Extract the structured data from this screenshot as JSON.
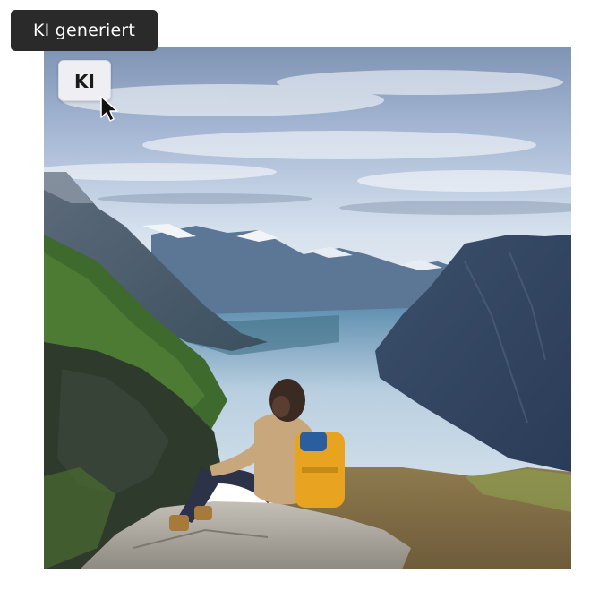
{
  "tooltip": {
    "text": "KI generiert"
  },
  "badge": {
    "label": "KI"
  },
  "photo": {
    "subject": "hiker-overlooking-fjord"
  },
  "icons": {
    "pointer": "mouse-pointer-icon"
  },
  "colors": {
    "tooltip_bg": "#2a2a2a",
    "badge_bg": "#eeeef3",
    "backpack": "#e8a320"
  }
}
